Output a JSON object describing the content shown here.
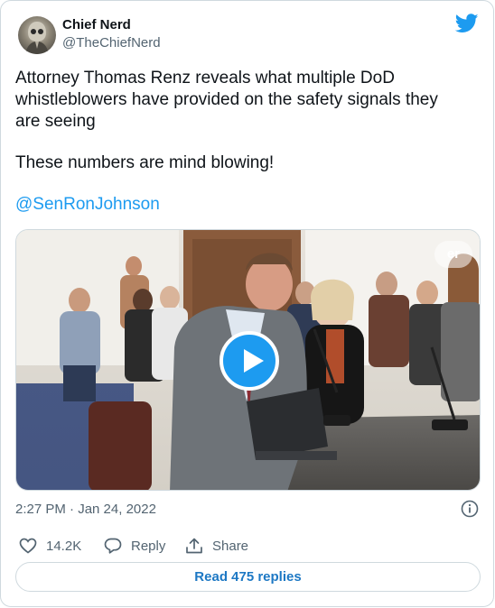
{
  "tweet": {
    "author_name": "Chief Nerd",
    "author_handle": "@TheChiefNerd",
    "text_lines": [
      "Attorney Thomas Renz reveals what multiple DoD",
      "whistleblowers have provided on the safety signals they",
      "are seeing",
      "These numbers are mind blowing!"
    ],
    "mention": "@SenRonJohnson",
    "timestamp": "2:27 PM · Jan 24, 2022",
    "likes": "14.2K",
    "reply_label": "Reply",
    "share_label": "Share",
    "read_replies_label": "Read 475 replies"
  },
  "media": {
    "type": "video",
    "corner_tag": "er"
  },
  "icons": {
    "brand": "twitter-bird-icon",
    "info": "info-icon",
    "like": "heart-icon",
    "reply": "reply-bubble-icon",
    "share": "share-upload-icon",
    "play": "play-icon"
  },
  "colors": {
    "accent": "#1d9bf0",
    "secondary_text": "#536471",
    "border": "#cfd9de"
  }
}
